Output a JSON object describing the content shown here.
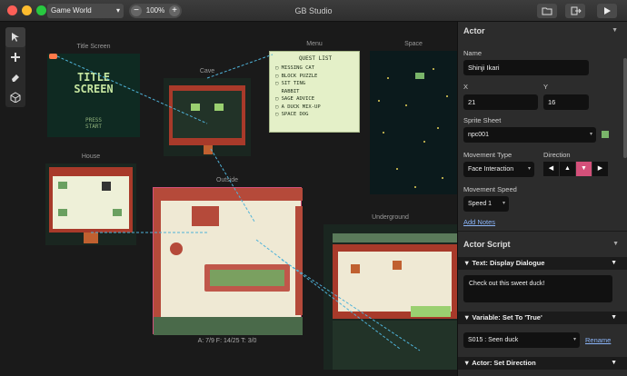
{
  "titlebar": {
    "project_select": "Game World",
    "zoom": "100%",
    "app_title": "GB Studio"
  },
  "scenes": [
    {
      "name": "Title Screen"
    },
    {
      "name": "Menu"
    },
    {
      "name": "Space"
    },
    {
      "name": "Cave"
    },
    {
      "name": "House"
    },
    {
      "name": "Outside"
    },
    {
      "name": "Underground"
    }
  ],
  "title_screen_text": {
    "line1": "TITLE",
    "line2": "SCREEN",
    "line3": "PRESS",
    "line4": "START"
  },
  "menu_text": {
    "heading": "QUEST LIST",
    "items": [
      "MISSING CAT",
      "BLOCK PUZZLE",
      "SIT TING",
      "RABBIT",
      "SAGE ADVICE",
      "A DUCK MIX-UP",
      "SPACE DOG"
    ]
  },
  "canvas_status": "A: 7/9   F: 14/25   T: 3/0",
  "actor_panel": {
    "header": "Actor",
    "name_label": "Name",
    "name_value": "Shinji Ikari",
    "x_label": "X",
    "x_value": "21",
    "y_label": "Y",
    "y_value": "16",
    "sprite_label": "Sprite Sheet",
    "sprite_value": "npc001",
    "movement_type_label": "Movement Type",
    "movement_type_value": "Face Interaction",
    "direction_label": "Direction",
    "movement_speed_label": "Movement Speed",
    "movement_speed_value": "Speed 1",
    "add_notes": "Add Notes"
  },
  "script_panel": {
    "header": "Actor Script",
    "events": [
      {
        "title": "Text: Display Dialogue",
        "text": "Check out this sweet duck!"
      },
      {
        "title": "Variable: Set To 'True'",
        "variable": "S015 : Seen duck",
        "rename": "Rename"
      },
      {
        "title": "Actor: Set Direction"
      }
    ]
  },
  "colors": {
    "accent_pink": "#d4507a",
    "panel_bg": "#2c2c2c",
    "canvas_bg": "#1a1a1a",
    "connector": "#4fb3d9"
  }
}
